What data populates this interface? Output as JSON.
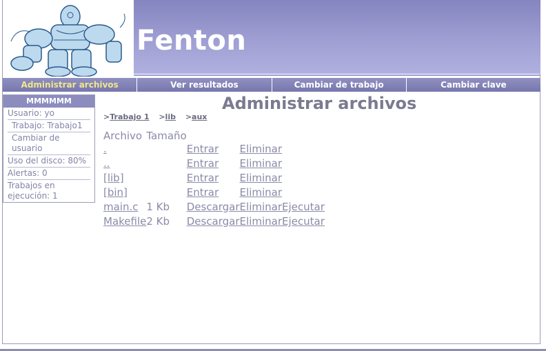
{
  "header": {
    "title": "Fenton"
  },
  "nav": {
    "items": [
      {
        "label": "Administrar archivos",
        "active": true
      },
      {
        "label": "Ver resultados",
        "active": false
      },
      {
        "label": "Cambiar de trabajo",
        "active": false
      },
      {
        "label": "Cambiar clave",
        "active": false
      }
    ]
  },
  "sidebar": {
    "header": "MMMMMM",
    "user": "Usuario: yo",
    "job": "Trabajo: Trabajo1",
    "change_user": "Cambiar de usuario",
    "disk": "Uso del disco: 80%",
    "alerts": "Alertas: 0",
    "running": "Trabajos en ejecución: 1"
  },
  "main": {
    "heading": "Administrar archivos",
    "breadcrumb": [
      {
        "prefix": ">",
        "label": "Trabajo 1"
      },
      {
        "prefix": ">",
        "label": "lib"
      },
      {
        "prefix": ">",
        "label": "aux"
      }
    ],
    "table": {
      "headers": [
        "Archivo",
        "Tamaño"
      ],
      "rows": [
        {
          "name": ".",
          "size": "",
          "a1": "Entrar",
          "a2": "Eliminar",
          "a3": ""
        },
        {
          "name": "..",
          "size": "",
          "a1": "Entrar",
          "a2": "Eliminar",
          "a3": ""
        },
        {
          "name": "[lib]",
          "size": "",
          "a1": "Entrar",
          "a2": "Eliminar",
          "a3": ""
        },
        {
          "name": "[bin]",
          "size": "",
          "a1": "Entrar",
          "a2": "Eliminar",
          "a3": ""
        },
        {
          "name": "main.c",
          "size": "1 Kb",
          "a1": "Descargar",
          "a2": "Eliminar",
          "a3": "Ejecutar"
        },
        {
          "name": "Makefile",
          "size": "2 Kb",
          "a1": "Descargar",
          "a2": "Eliminar",
          "a3": "Ejecutar"
        }
      ]
    }
  },
  "colors": {
    "banner": "#8585c0",
    "nav": "#8282b8",
    "nav_active_text": "#f0e68c",
    "text": "#8a8aa8"
  }
}
